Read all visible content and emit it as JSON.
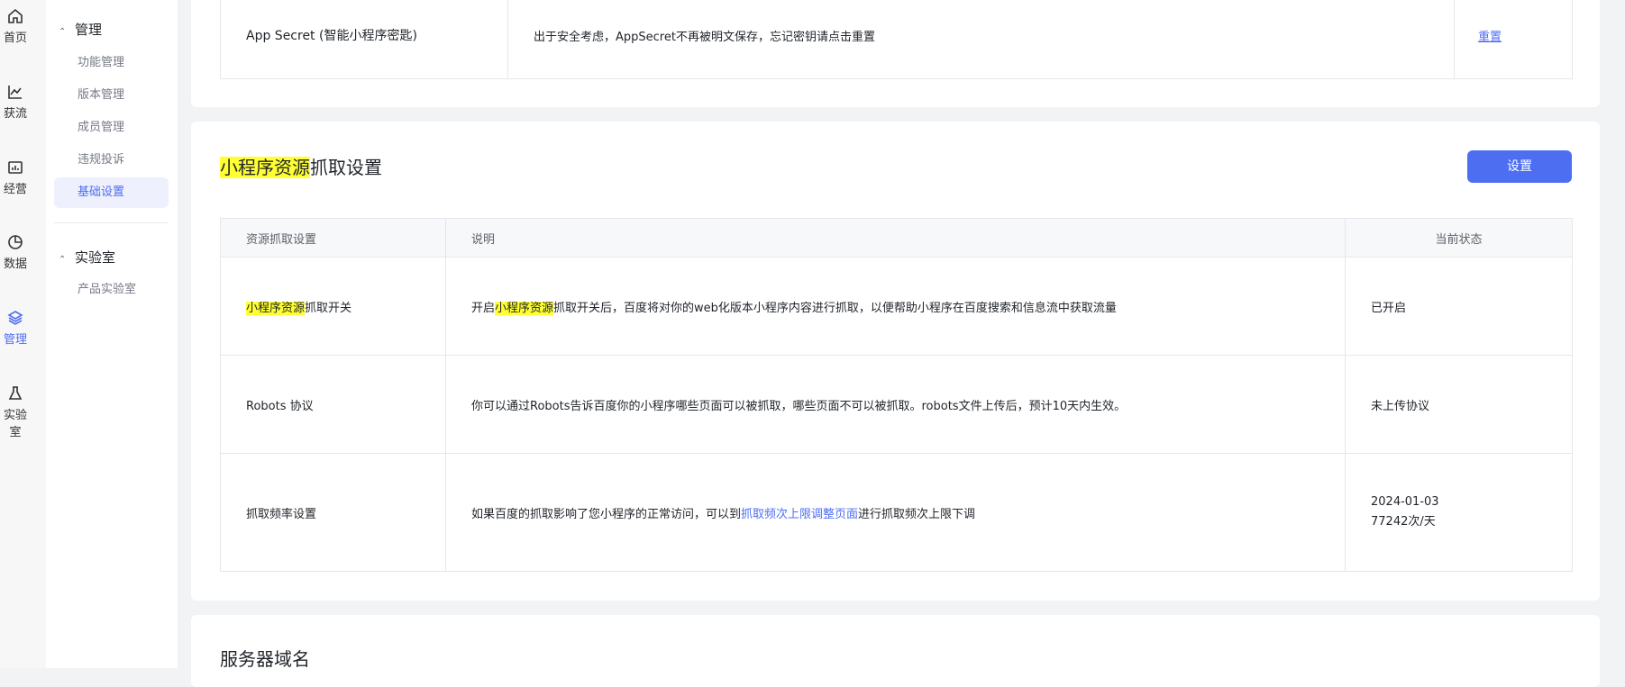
{
  "rail": [
    {
      "label": "首页",
      "icon": "home-icon"
    },
    {
      "label": "获流",
      "icon": "trend-icon"
    },
    {
      "label": "经营",
      "icon": "chart-box-icon"
    },
    {
      "label": "数据",
      "icon": "pie-icon"
    },
    {
      "label": "管理",
      "icon": "layers-icon",
      "active": true
    },
    {
      "label": "实验室",
      "icon": "flask-icon"
    }
  ],
  "subnav": {
    "group1": "管理",
    "items": [
      "功能管理",
      "版本管理",
      "成员管理",
      "违规投诉",
      "基础设置"
    ],
    "group2": "实验室",
    "items2": [
      "产品实验室"
    ]
  },
  "top_card": {
    "row_label": "App Secret (智能小程序密匙)",
    "row_desc": "出于安全考虑，AppSecret不再被明文保存，忘记密钥请点击重置",
    "row_action": "重置"
  },
  "crawl_card": {
    "title_hl": "小程序资源",
    "title_rest": "抓取设置",
    "button": "设置",
    "headers": [
      "资源抓取设置",
      "说明",
      "当前状态"
    ],
    "row1": {
      "name_hl": "小程序资源",
      "name_rest": "抓取开关",
      "desc_pre": "开启",
      "desc_hl": "小程序资源",
      "desc_post": "抓取开关后，百度将对你的web化版本小程序内容进行抓取，以便帮助小程序在百度搜索和信息流中获取流量",
      "status": "已开启"
    },
    "row2": {
      "name": "Robots 协议",
      "desc": "你可以通过Robots告诉百度你的小程序哪些页面可以被抓取，哪些页面不可以被抓取。robots文件上传后，预计10天内生效。",
      "status": "未上传协议"
    },
    "row3": {
      "name": "抓取频率设置",
      "desc_pre": "如果百度的抓取影响了您小程序的正常访问，可以到",
      "desc_link": "抓取频次上限调整页面",
      "desc_post": "进行抓取频次上限下调",
      "status_line1": "2024-01-03",
      "status_line2": "77242次/天"
    }
  },
  "server_card": {
    "title": "服务器域名"
  }
}
